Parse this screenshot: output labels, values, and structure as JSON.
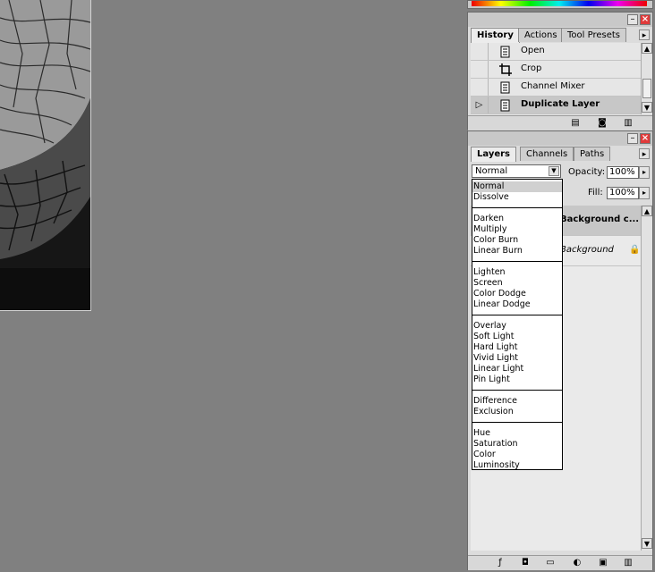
{
  "history_panel": {
    "tabs": [
      "History",
      "Actions",
      "Tool Presets"
    ],
    "active_tab": "History",
    "items": [
      {
        "label": "Open",
        "icon": "document-icon",
        "current": false
      },
      {
        "label": "Crop",
        "icon": "crop-icon",
        "current": false
      },
      {
        "label": "Channel Mixer",
        "icon": "document-icon",
        "current": false
      },
      {
        "label": "Duplicate Layer",
        "icon": "document-icon",
        "current": true
      }
    ],
    "bottom_icons": [
      "new-document-icon",
      "camera-icon",
      "trash-icon"
    ]
  },
  "layers_panel": {
    "tabs": [
      "Layers",
      "Channels",
      "Paths"
    ],
    "active_tab": "Layers",
    "blend_mode": "Normal",
    "opacity_label": "Opacity:",
    "opacity_value": "100%",
    "fill_label": "Fill:",
    "fill_value": "100%",
    "layers": [
      {
        "name": "Background c...",
        "selected": true
      },
      {
        "name": "Background",
        "selected": false,
        "locked": true
      }
    ],
    "bottom_icons": [
      "layer-style-icon",
      "mask-icon",
      "folder-icon",
      "adjustment-icon",
      "new-layer-icon",
      "trash-icon"
    ]
  },
  "blend_menu": {
    "groups": [
      [
        "Normal",
        "Dissolve"
      ],
      [
        "Darken",
        "Multiply",
        "Color Burn",
        "Linear Burn"
      ],
      [
        "Lighten",
        "Screen",
        "Color Dodge",
        "Linear Dodge"
      ],
      [
        "Overlay",
        "Soft Light",
        "Hard Light",
        "Vivid Light",
        "Linear Light",
        "Pin Light"
      ],
      [
        "Difference",
        "Exclusion"
      ],
      [
        "Hue",
        "Saturation",
        "Color",
        "Luminosity"
      ]
    ],
    "selected": "Normal"
  },
  "colors": {
    "workspace": "#808080",
    "panel": "#dcdcdc",
    "close_button": "#e03a3a",
    "selected_row": "#c7c7c7"
  }
}
